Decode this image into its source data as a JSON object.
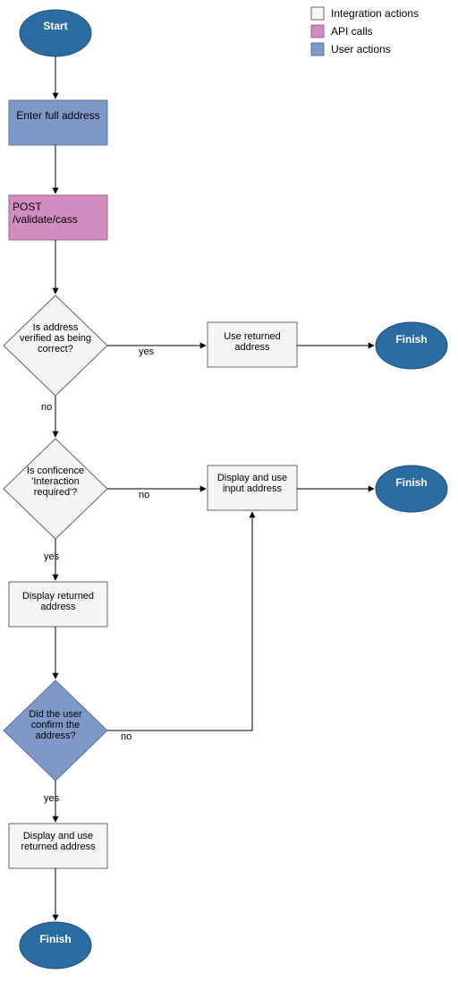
{
  "legend": {
    "items": [
      {
        "label": "Integration actions",
        "fill": "#f5f5f5",
        "stroke": "#666666"
      },
      {
        "label": "API calls",
        "fill": "#d18dbf",
        "stroke": "#a0638f"
      },
      {
        "label": "User actions",
        "fill": "#7e99c8",
        "stroke": "#5a73a0"
      }
    ]
  },
  "nodes": {
    "start": {
      "label": "Start"
    },
    "enter": {
      "label": "Enter full address"
    },
    "post": {
      "label": "POST /validate/cass"
    },
    "verified": {
      "label": "Is address verified as being correct?"
    },
    "useRet": {
      "label": "Use returned address"
    },
    "finish1": {
      "label": "Finish"
    },
    "conf": {
      "label": "Is conficence 'Interaction required'?"
    },
    "dispIn": {
      "label": "Display and use input address"
    },
    "finish2": {
      "label": "Finish"
    },
    "dispRet": {
      "label": "Display returned address"
    },
    "confirm": {
      "label": "Did the user confirm the address?"
    },
    "dispRet2": {
      "label": "Display and use returned address"
    },
    "finish3": {
      "label": "Finish"
    }
  },
  "edges": {
    "yes": "yes",
    "no": "no"
  },
  "colors": {
    "terminalFill": "#2b6ca3",
    "terminalStroke": "#1f4f78",
    "userFill": "#7e99c8",
    "userStroke": "#5a73a0",
    "apiFill": "#d18dbf",
    "apiStroke": "#a0638f",
    "actionFill": "#f5f5f5",
    "actionStroke": "#666666",
    "decisionUserFill": "#7e99c8",
    "arrow": "#000000"
  }
}
